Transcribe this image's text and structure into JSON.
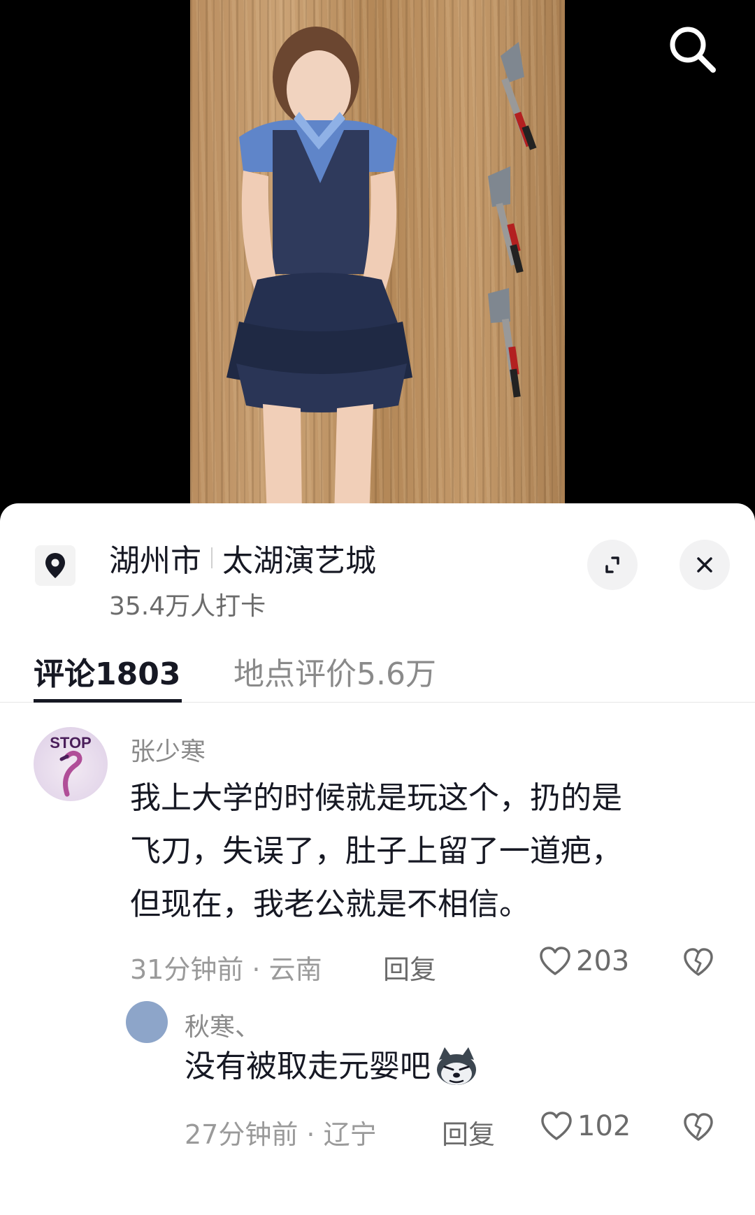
{
  "location": {
    "city": "湖州市",
    "venue": "太湖演艺城",
    "checkins": "35.4万人打卡"
  },
  "icons": {
    "search": "search-icon",
    "pin": "location-pin-icon",
    "expand": "expand-icon",
    "close": "close-icon",
    "like": "heart-outline-icon",
    "dislike": "broken-heart-icon"
  },
  "tabs": [
    {
      "label": "评论1803",
      "active": true
    },
    {
      "label": "地点评价5.6万",
      "active": false
    }
  ],
  "comments": [
    {
      "user": "张少寒",
      "avatar_text": "STOP",
      "lines": [
        "我上大学的时候就是玩这个，扔的是",
        "飞刀，失误了，肚子上留了一道疤，",
        "但现在，我老公就是不相信。"
      ],
      "meta": "31分钟前 · 云南",
      "reply_label": "回复",
      "likes": "203",
      "replies": [
        {
          "user": "秋寒、",
          "text": "没有被取走元婴吧",
          "emoji": "husky-sticker",
          "meta": "27分钟前 · 辽宁",
          "reply_label": "回复",
          "likes": "102"
        }
      ]
    }
  ],
  "colors": {
    "text_primary": "#161823",
    "text_secondary": "#8a8a8a",
    "divider": "#e6e6e6",
    "sheet_bg": "#ffffff",
    "video_bg": "#000000"
  }
}
